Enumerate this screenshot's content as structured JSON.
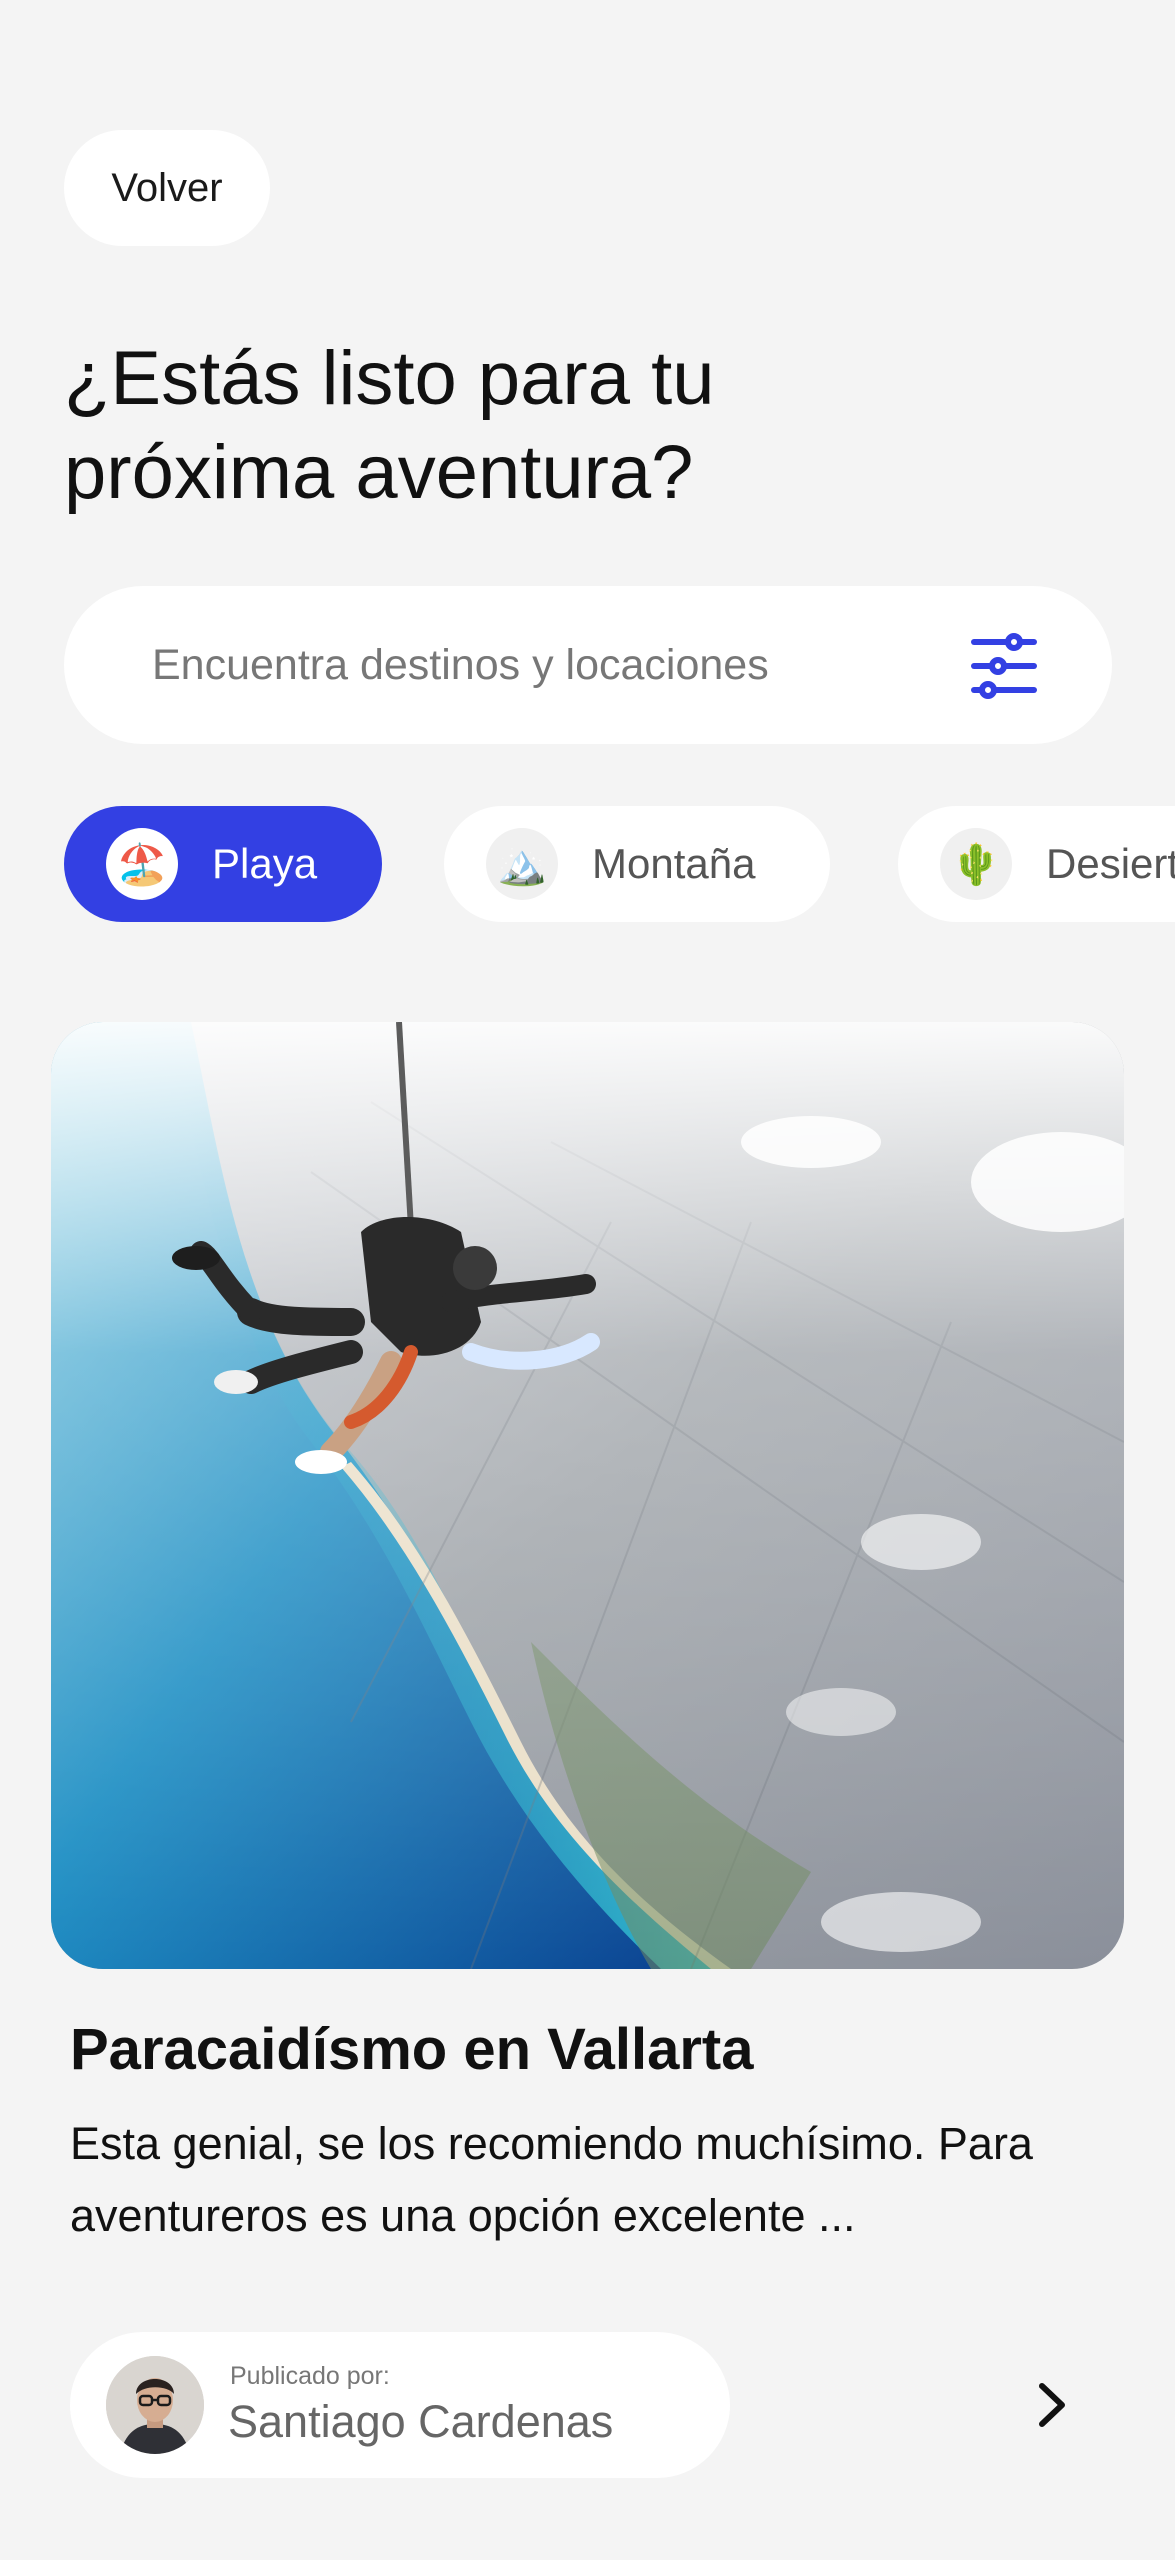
{
  "header": {
    "back_label": "Volver",
    "headline": "¿Estás listo para tu próxima aventura?"
  },
  "search": {
    "placeholder": "Encuentra destinos y locaciones",
    "filter_icon": "sliders-icon"
  },
  "categories": [
    {
      "label": "Playa",
      "emoji": "🏖️",
      "icon": "beach-umbrella-icon",
      "active": true
    },
    {
      "label": "Montaña",
      "emoji": "🏔️",
      "icon": "mountain-icon",
      "active": false
    },
    {
      "label": "Desierto",
      "emoji": "🌵",
      "icon": "cactus-icon",
      "active": false
    }
  ],
  "card": {
    "title": "Paracaidísmo en Vallarta",
    "description": "Esta genial, se los recomiendo muchísimo. Para aventureros es una opción excelente ...",
    "posted_by_label": "Publicado por:",
    "author_name": "Santiago Cardenas",
    "next_icon": "chevron-right-icon"
  },
  "colors": {
    "accent": "#3340e3",
    "background": "#f4f4f4",
    "surface": "#ffffff"
  }
}
